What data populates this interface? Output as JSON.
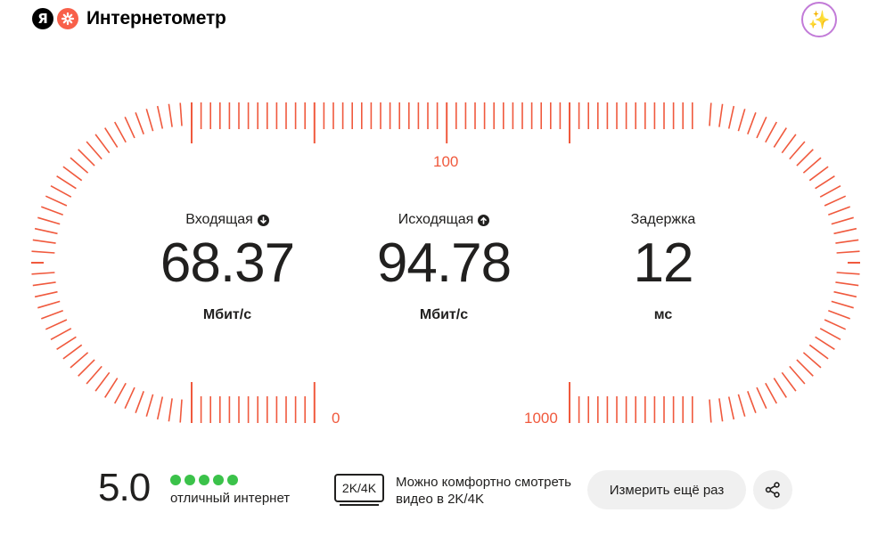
{
  "header": {
    "ya_logo_letter": "Я",
    "title": "Интернетометр",
    "ai_icon": "sparkles-icon"
  },
  "gauge": {
    "accent_color": "#f0593d",
    "scale_labels": {
      "top": "100",
      "left": "0",
      "right": "1000"
    }
  },
  "metrics": {
    "download": {
      "label": "Входящая",
      "value": "68.37",
      "unit": "Мбит/с",
      "icon": "arrow-down-icon"
    },
    "upload": {
      "label": "Исходящая",
      "value": "94.78",
      "unit": "Мбит/с",
      "icon": "arrow-up-icon"
    },
    "latency": {
      "label": "Задержка",
      "value": "12",
      "unit": "мс"
    }
  },
  "rating": {
    "value": "5.0",
    "stars": 5,
    "max_stars": 5,
    "text": "отличный интернет",
    "color": "#3bc24a"
  },
  "video": {
    "badge": "2K/4K",
    "text": "Можно комфортно смотреть видео в 2K/4K"
  },
  "actions": {
    "retry_label": "Измерить ещё раз",
    "share_icon": "share-icon"
  }
}
